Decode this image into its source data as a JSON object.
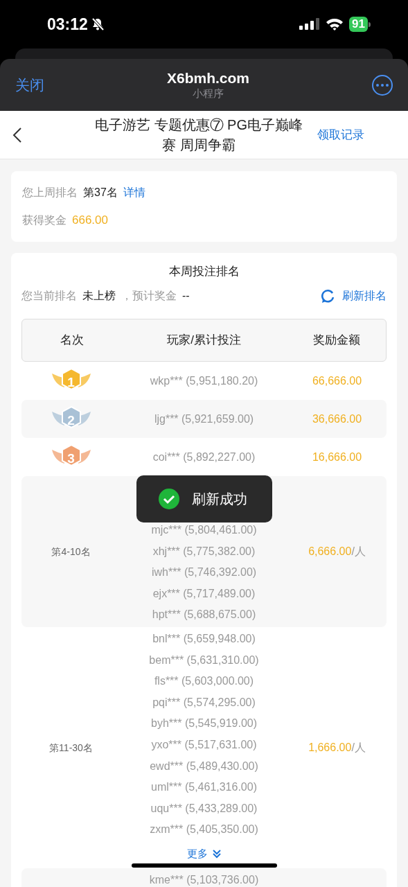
{
  "status_bar": {
    "time": "03:12",
    "battery": "91"
  },
  "mini_program_bar": {
    "close": "关闭",
    "title": "X6bmh.com",
    "subtitle": "小程序"
  },
  "nav_bar": {
    "title": "电子游艺 专题优惠⑦ PG电子巅峰赛 周周争霸",
    "action": "领取记录"
  },
  "last_week": {
    "rank_label": "您上周排名",
    "rank": "第37名",
    "details_link": "详情",
    "bonus_label": "获得奖金",
    "bonus": "666.00"
  },
  "this_week": {
    "title": "本周投注排名",
    "current_label": "您当前排名",
    "current": "未上榜",
    "estimate_label": "，预计奖金",
    "estimate": "--",
    "refresh": "刷新排名"
  },
  "table": {
    "columns": [
      "名次",
      "玩家/累计投注",
      "奖励金额"
    ],
    "top_rows": [
      {
        "rank": "1",
        "color": "#f5b82e",
        "player": "wkp*** (5,951,180.20)",
        "prize": "66,666.00"
      },
      {
        "rank": "2",
        "color": "#a9c1d6",
        "player": "ljg*** (5,921,659.00)",
        "prize": "36,666.00"
      },
      {
        "rank": "3",
        "color": "#f0a070",
        "player": "coi*** (5,892,227.00)",
        "prize": "16,666.00"
      }
    ],
    "groups": [
      {
        "label": "第4-10名",
        "prize": "6,666.00",
        "unit": "/人",
        "toast": {
          "text": "刷新成功"
        },
        "players": [
          "mjc*** (5,804,461.00)",
          "xhj*** (5,775,382.00)",
          "iwh*** (5,746,392.00)",
          "ejx*** (5,717,489.00)",
          "hpt*** (5,688,675.00)"
        ]
      },
      {
        "label": "第11-30名",
        "prize": "1,666.00",
        "unit": "/人",
        "players": [
          "bnl*** (5,659,948.00)",
          "bem*** (5,631,310.00)",
          "fls*** (5,603,000.00)",
          "pqi*** (5,574,295.00)",
          "byh*** (5,545,919.00)",
          "yxo*** (5,517,631.00)",
          "ewd*** (5,489,430.00)",
          "uml*** (5,461,316.00)",
          "uqu*** (5,433,289.00)",
          "zxm*** (5,405,350.00)"
        ],
        "more": "更多"
      },
      {
        "players": [
          "kme*** (5,103,736.00)"
        ]
      }
    ]
  }
}
